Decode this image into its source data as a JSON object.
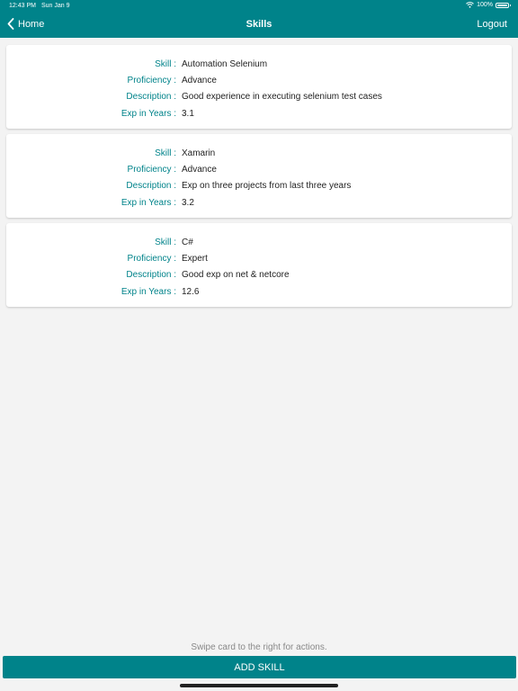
{
  "status_bar": {
    "time": "12:43 PM",
    "date": "Sun Jan 9",
    "battery": "100%"
  },
  "nav": {
    "back_label": "Home",
    "title": "Skills",
    "logout_label": "Logout"
  },
  "labels": {
    "skill": "Skill :",
    "proficiency": "Proficiency :",
    "description": "Description :",
    "exp": "Exp in Years :"
  },
  "skills": [
    {
      "skill": "Automation Selenium",
      "proficiency": "Advance",
      "description": "Good experience in executing selenium test cases",
      "exp": "3.1"
    },
    {
      "skill": "Xamarin",
      "proficiency": "Advance",
      "description": "Exp on three projects from last three years",
      "exp": "3.2"
    },
    {
      "skill": "C#",
      "proficiency": "Expert",
      "description": "Good exp on net & netcore",
      "exp": "12.6"
    }
  ],
  "footer": {
    "hint": "Swipe card to the right for actions.",
    "add_label": "ADD SKILL"
  },
  "colors": {
    "accent": "#00838a",
    "background": "#f3f3f3",
    "card": "#ffffff"
  },
  "icons": {
    "back": "chevron-left-icon",
    "wifi": "wifi-icon",
    "battery": "battery-icon"
  }
}
